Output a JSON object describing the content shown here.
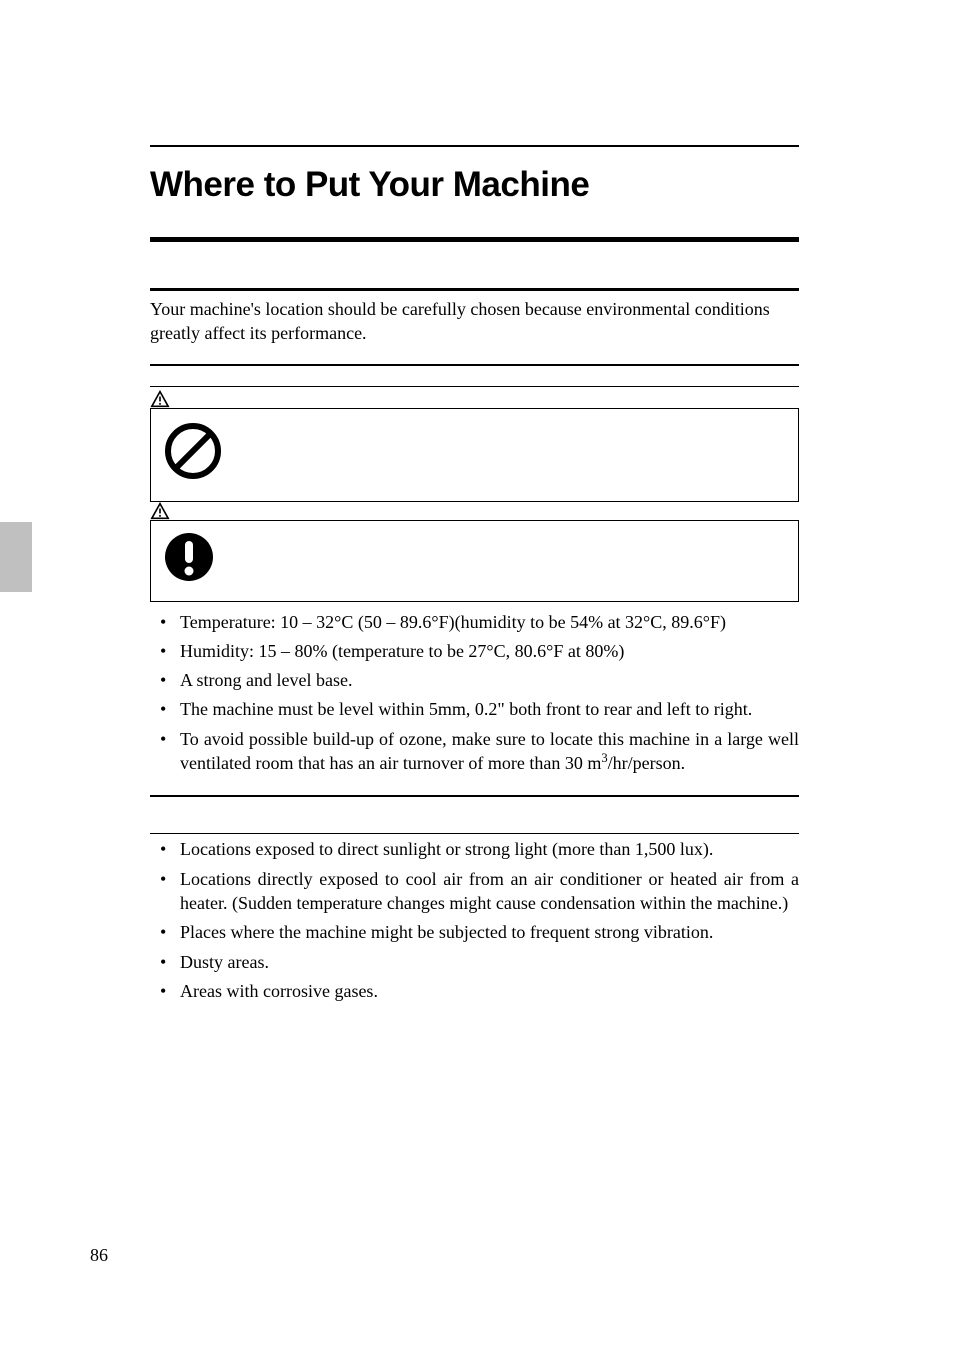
{
  "title": "Where to Put Your Machine",
  "intro": "Your machine's location should be carefully chosen because environmental conditions greatly affect its performance.",
  "environment_bullets": [
    "Temperature: 10 – 32°C (50 – 89.6°F)(humidity to be 54% at 32°C, 89.6°F)",
    "Humidity: 15 – 80% (temperature to be 27°C, 80.6°F at 80%)",
    "A strong and level base.",
    "The machine must be level within 5mm, 0.2\" both front to rear and left to right.",
    "To avoid possible build-up of ozone, make sure to locate this machine in a large well ventilated room that has an air turnover of more than 30 m³/hr/person."
  ],
  "avoid_bullets": [
    "Locations exposed to direct sunlight or strong light (more than 1,500 lux).",
    "Locations directly exposed to cool air from an air conditioner or heated air from a heater. (Sudden temperature changes might cause condensation within the machine.)",
    "Places where the machine might be subjected to frequent strong vibration.",
    "Dusty areas.",
    "Areas with corrosive gases."
  ],
  "page_number": "86"
}
